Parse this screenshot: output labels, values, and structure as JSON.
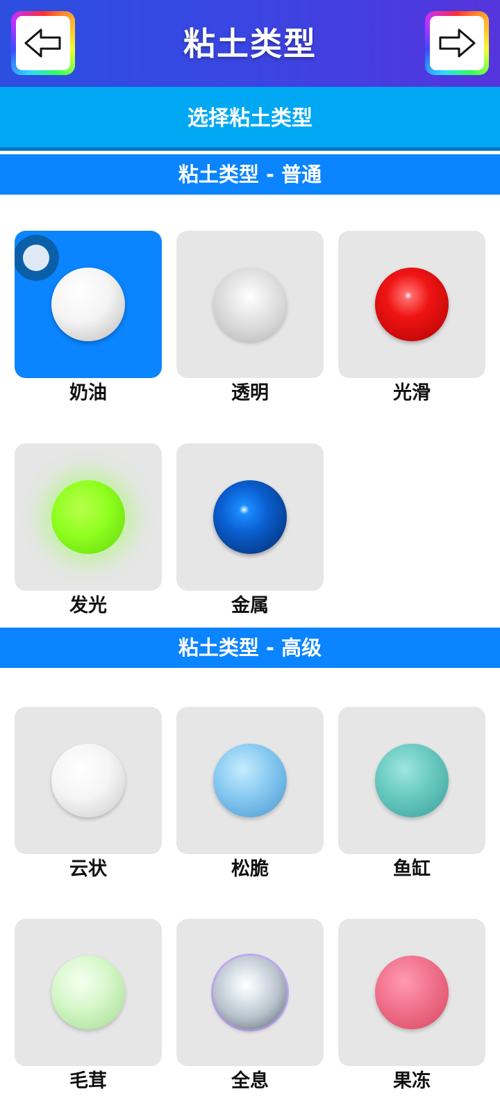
{
  "header": {
    "title": "粘土类型",
    "back_icon": "arrow-left-icon",
    "forward_icon": "arrow-right-icon"
  },
  "subheader": {
    "title": "选择粘土类型"
  },
  "sections": [
    {
      "title": "粘土类型 - 普通",
      "items": [
        {
          "label": "奶油",
          "selected": true,
          "color": "#f2f2f2"
        },
        {
          "label": "透明",
          "selected": false,
          "color": "#d9d9d9"
        },
        {
          "label": "光滑",
          "selected": false,
          "color": "#e81a1a"
        },
        {
          "label": "发光",
          "selected": false,
          "color": "#8fff1f"
        },
        {
          "label": "金属",
          "selected": false,
          "color": "#0a4ea8"
        }
      ]
    },
    {
      "title": "粘土类型 - 高级",
      "items": [
        {
          "label": "云状",
          "selected": false,
          "color": "#f4f4f4"
        },
        {
          "label": "松脆",
          "selected": false,
          "color": "#7fc4ee"
        },
        {
          "label": "鱼缸",
          "selected": false,
          "color": "#5cc4bd"
        },
        {
          "label": "毛茸",
          "selected": false,
          "color": "#d4f8c8"
        },
        {
          "label": "全息",
          "selected": false,
          "color": "#cfd6dc"
        },
        {
          "label": "果冻",
          "selected": false,
          "color": "#f26b85"
        }
      ]
    }
  ]
}
